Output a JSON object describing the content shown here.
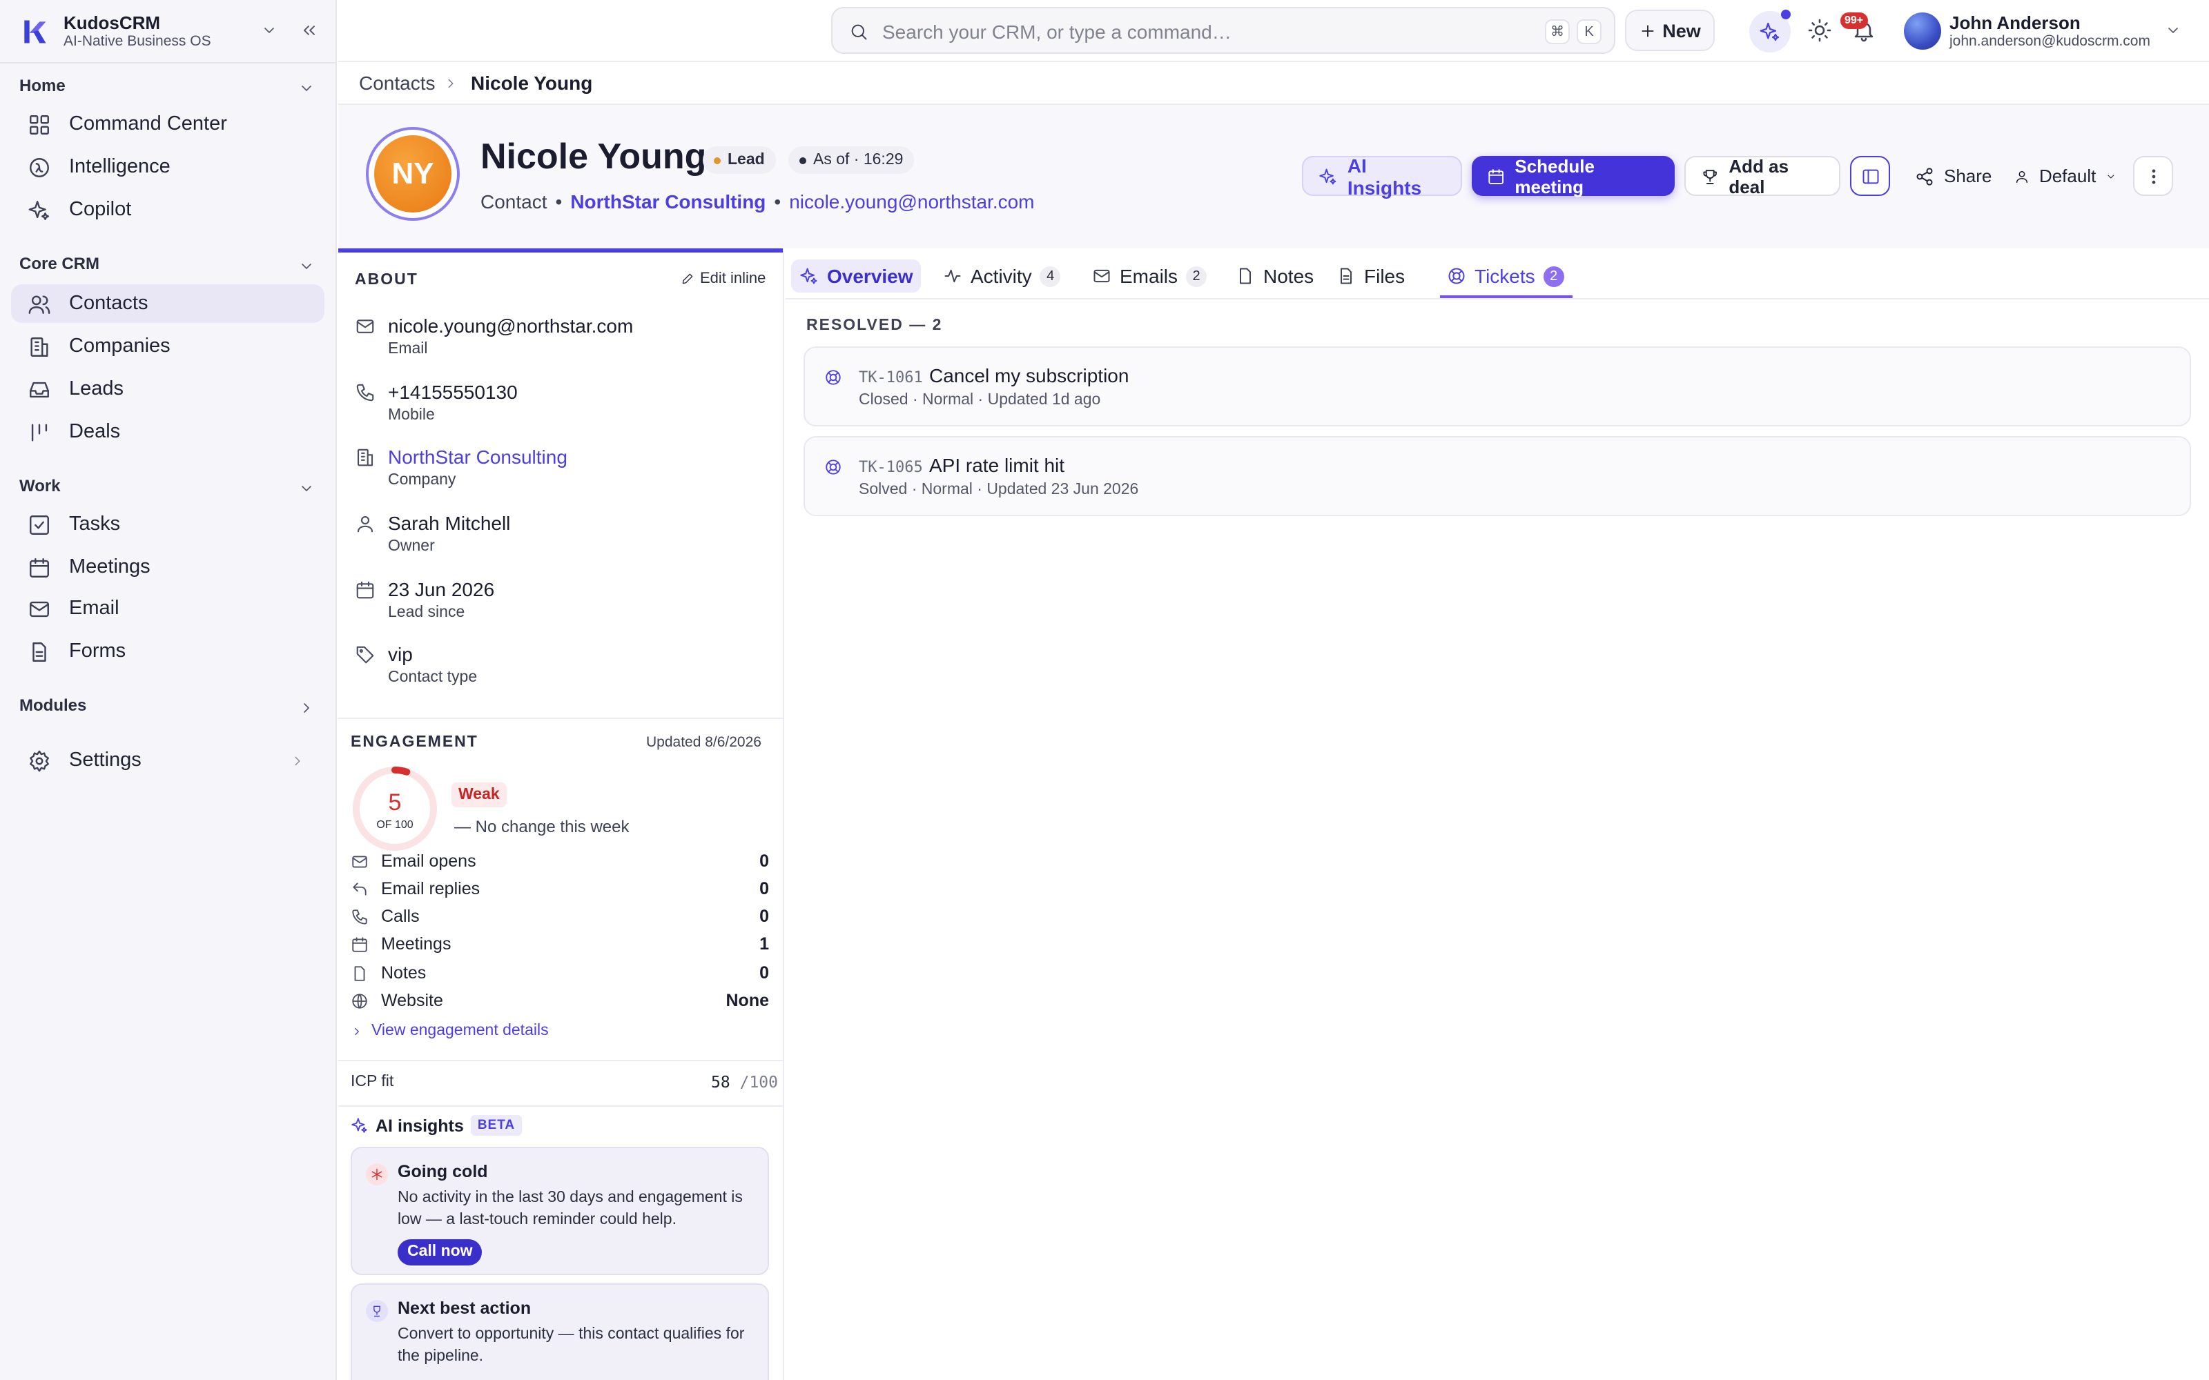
{
  "brand": {
    "name": "KudosCRM",
    "tagline": "AI-Native Business OS"
  },
  "sidebar": {
    "sections": [
      {
        "title": "Home",
        "items": [
          "Command Center",
          "Intelligence",
          "Copilot"
        ]
      },
      {
        "title": "Core CRM",
        "items": [
          "Contacts",
          "Companies",
          "Leads",
          "Deals"
        ]
      },
      {
        "title": "Work",
        "items": [
          "Tasks",
          "Meetings",
          "Email",
          "Forms"
        ]
      },
      {
        "title": "Modules",
        "items": []
      }
    ],
    "settings": "Settings",
    "active_item": "Contacts"
  },
  "topbar": {
    "search_placeholder": "Search your CRM, or type a command…",
    "kbd": [
      "⌘",
      "K"
    ],
    "new_label": "New",
    "notif_badge": "99+",
    "user": {
      "name": "John Anderson",
      "email": "john.anderson@kudoscrm.com"
    }
  },
  "breadcrumb": {
    "parent": "Contacts",
    "current": "Nicole Young"
  },
  "contact": {
    "initials": "NY",
    "name": "Nicole Young",
    "status": "Lead",
    "status_color": "#e0962a",
    "as_of": "As of · 16:29",
    "type": "Contact",
    "company": "NorthStar Consulting",
    "email": "nicole.young@northstar.com"
  },
  "actions": {
    "ai_insights": "AI Insights",
    "schedule": "Schedule meeting",
    "add_deal": "Add as deal",
    "share": "Share",
    "view": "Default"
  },
  "about": {
    "title": "ABOUT",
    "edit": "Edit inline",
    "fields": [
      {
        "value": "nicole.young@northstar.com",
        "label": "Email",
        "icon": "mail-icon"
      },
      {
        "value": "+14155550130",
        "label": "Mobile",
        "icon": "phone-icon"
      },
      {
        "value": "NorthStar Consulting",
        "label": "Company",
        "icon": "building-icon"
      },
      {
        "value": "Sarah Mitchell",
        "label": "Owner",
        "icon": "user-icon"
      },
      {
        "value": "23 Jun 2026",
        "label": "Lead since",
        "icon": "calendar-icon"
      },
      {
        "value": "vip",
        "label": "Contact type",
        "icon": "tag-icon"
      }
    ]
  },
  "engagement": {
    "title": "ENGAGEMENT",
    "updated": "Updated 8/6/2026",
    "score": "5",
    "score_of": "OF 100",
    "score_fraction": 0.05,
    "rating": "Weak",
    "trend": "— No change this week",
    "rows": [
      {
        "label": "Email opens",
        "value": "0"
      },
      {
        "label": "Email replies",
        "value": "0"
      },
      {
        "label": "Calls",
        "value": "0"
      },
      {
        "label": "Meetings",
        "value": "1"
      },
      {
        "label": "Notes",
        "value": "0"
      },
      {
        "label": "Website",
        "value": "None"
      }
    ],
    "details_link": "View engagement details",
    "icp_label": "ICP fit",
    "icp_value": "58",
    "icp_max": "/100"
  },
  "ai_insights": {
    "title": "AI insights",
    "badge": "BETA",
    "cards": [
      {
        "title": "Going cold",
        "body": "No activity in the last 30 days and engagement is low — a last-touch reminder could help.",
        "cta": "Call now"
      },
      {
        "title": "Next best action",
        "body": "Convert to opportunity — this contact qualifies for the pipeline."
      }
    ]
  },
  "tabs": [
    {
      "label": "Overview",
      "count": ""
    },
    {
      "label": "Activity",
      "count": "4"
    },
    {
      "label": "Emails",
      "count": "2"
    },
    {
      "label": "Notes",
      "count": ""
    },
    {
      "label": "Files",
      "count": ""
    },
    {
      "label": "Tickets",
      "count": "2"
    }
  ],
  "tickets": {
    "group": "RESOLVED — 2",
    "items": [
      {
        "id": "TK-1061",
        "title": "Cancel my subscription",
        "meta": "Closed · Normal · Updated 1d ago"
      },
      {
        "id": "TK-1065",
        "title": "API rate limit hit",
        "meta": "Solved · Normal · Updated 23 Jun 2026"
      }
    ]
  },
  "colors": {
    "accent": "#4b3fe0",
    "weak": "#d62f2f",
    "avatar": "#f08a1c"
  }
}
